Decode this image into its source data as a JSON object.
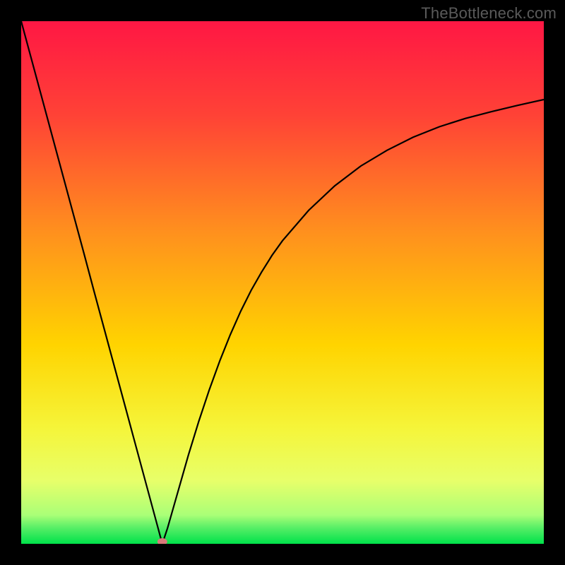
{
  "watermark": "TheBottleneck.com",
  "chart_data": {
    "type": "line",
    "title": "",
    "xlabel": "",
    "ylabel": "",
    "xlim": [
      0,
      100
    ],
    "ylim": [
      0,
      100
    ],
    "x": [
      0,
      2,
      4,
      6,
      8,
      10,
      12,
      14,
      16,
      18,
      20,
      22,
      24,
      26,
      27,
      28,
      30,
      32,
      34,
      36,
      38,
      40,
      42,
      44,
      46,
      48,
      50,
      55,
      60,
      65,
      70,
      75,
      80,
      85,
      90,
      95,
      100
    ],
    "values": [
      100,
      92.6,
      85.2,
      77.8,
      70.4,
      63.0,
      55.6,
      48.1,
      40.7,
      33.3,
      25.9,
      18.5,
      11.1,
      3.7,
      0.0,
      3.0,
      10.0,
      17.0,
      23.5,
      29.5,
      35.0,
      40.0,
      44.5,
      48.5,
      52.0,
      55.2,
      58.0,
      63.8,
      68.5,
      72.3,
      75.3,
      77.8,
      79.8,
      81.4,
      82.7,
      83.9,
      85.0
    ],
    "minimum_marker": {
      "x": 27,
      "y": 0
    },
    "gradient_stops": [
      {
        "offset": 0.0,
        "color": "#ff1744"
      },
      {
        "offset": 0.18,
        "color": "#ff4236"
      },
      {
        "offset": 0.4,
        "color": "#ff8f1e"
      },
      {
        "offset": 0.62,
        "color": "#ffd400"
      },
      {
        "offset": 0.78,
        "color": "#f5f53a"
      },
      {
        "offset": 0.88,
        "color": "#e7ff6a"
      },
      {
        "offset": 0.945,
        "color": "#aaff77"
      },
      {
        "offset": 0.97,
        "color": "#55ee66"
      },
      {
        "offset": 1.0,
        "color": "#00e24a"
      }
    ],
    "marker_color": "#d87a7a"
  }
}
